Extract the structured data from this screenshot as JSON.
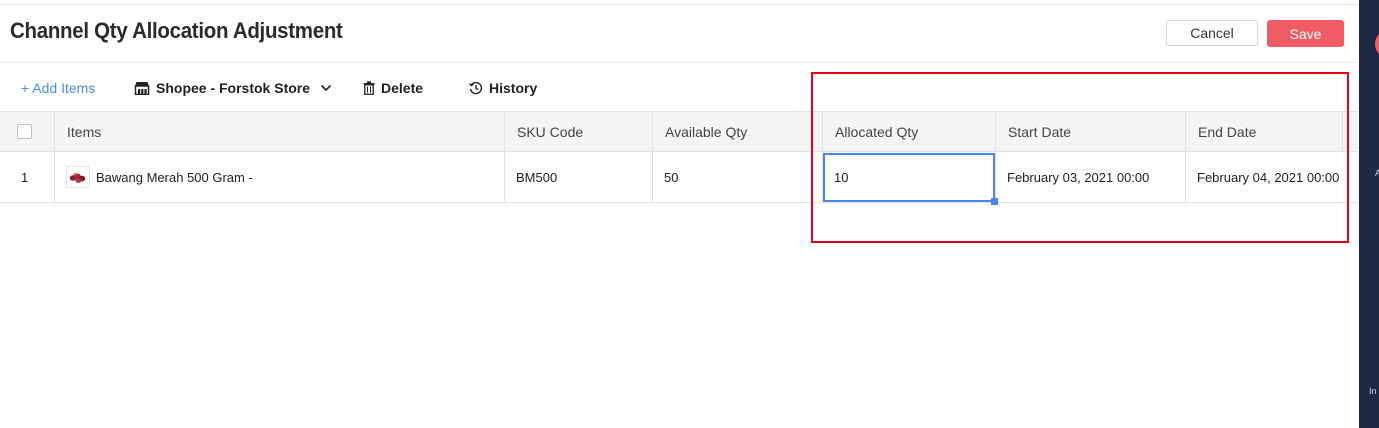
{
  "header": {
    "title": "Channel Qty Allocation Adjustment",
    "cancel_label": "Cancel",
    "save_label": "Save"
  },
  "toolbar": {
    "add_items_label": "+ Add Items",
    "channel_label": "Shopee - Forstok Store",
    "delete_label": "Delete",
    "history_label": "History"
  },
  "table": {
    "columns": [
      "Items",
      "SKU Code",
      "Available Qty",
      "Allocated Qty",
      "Start Date",
      "End Date"
    ],
    "rows": [
      {
        "index": "1",
        "item": "Bawang Merah 500 Gram -",
        "sku": "BM500",
        "available_qty": "50",
        "allocated_qty": "10",
        "start_date": "February 03, 2021 00:00",
        "end_date": "February 04, 2021 00:00"
      }
    ]
  },
  "side_panel": {
    "text_a": "A",
    "text_b": "In"
  },
  "colors": {
    "save_button": "#f15b64",
    "link": "#4a90d9",
    "input_focus": "#4a86e8",
    "highlight": "#e3001b",
    "side_panel": "#1e2a44"
  },
  "icons": [
    "store-icon",
    "trash-icon",
    "history-icon",
    "chevron-down-icon",
    "checkbox-icon"
  ]
}
